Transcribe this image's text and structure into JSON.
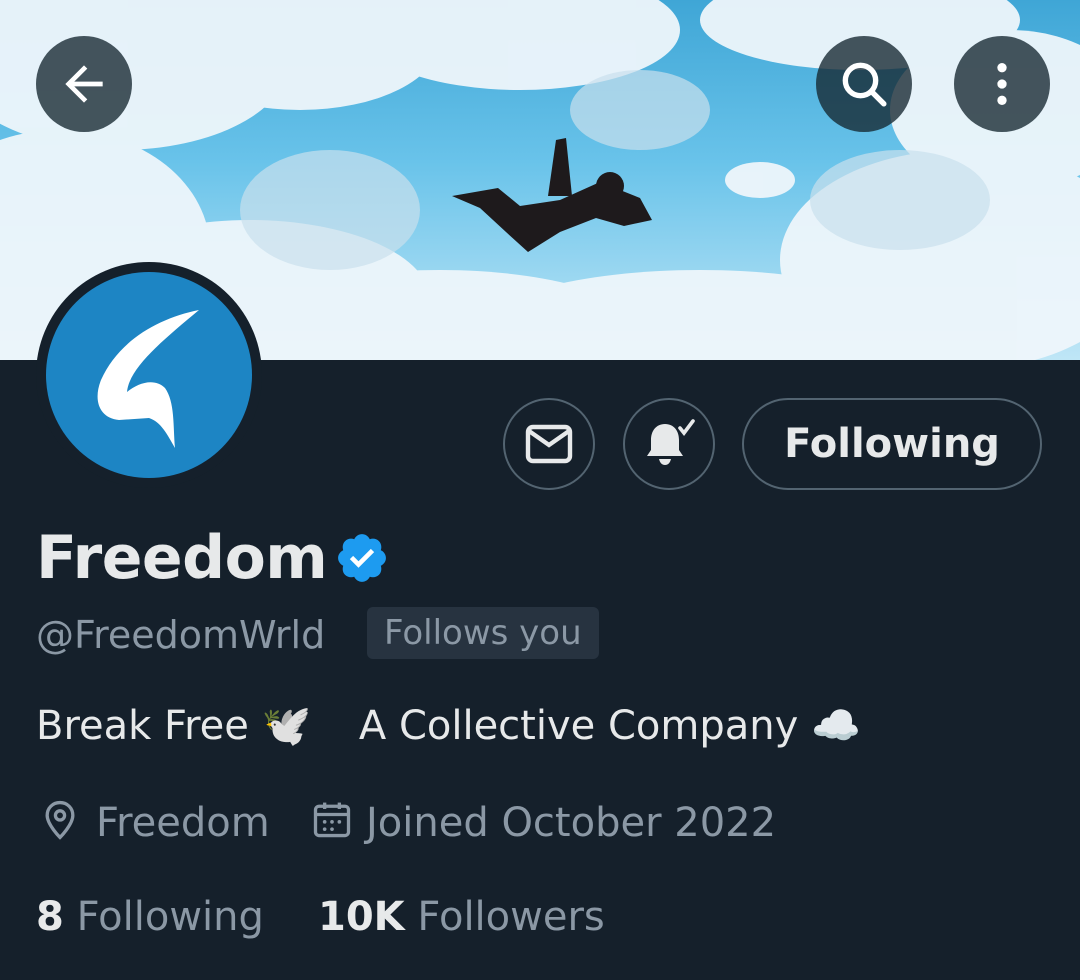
{
  "header": {
    "back_icon": "arrow-left-icon",
    "search_icon": "search-icon",
    "more_icon": "more-vertical-icon"
  },
  "profile": {
    "display_name": "Freedom",
    "verified_icon": "verified-badge-icon",
    "handle": "@FreedomWrld",
    "follows_you": "Follows you",
    "bio_part1": "Break Free 🕊️",
    "bio_part2": "A Collective Company ☁️",
    "location": "Freedom",
    "joined": "Joined October 2022",
    "following_count": "8",
    "following_label": "Following",
    "followers_count": "10K",
    "followers_label": "Followers"
  },
  "actions": {
    "message_icon": "mail-icon",
    "notify_icon": "bell-check-icon",
    "following_button": "Following"
  },
  "colors": {
    "background": "#15202b",
    "avatar_bg": "#1d85c4",
    "verified_blue": "#1d9bf0",
    "secondary_text": "#8b98a5"
  }
}
